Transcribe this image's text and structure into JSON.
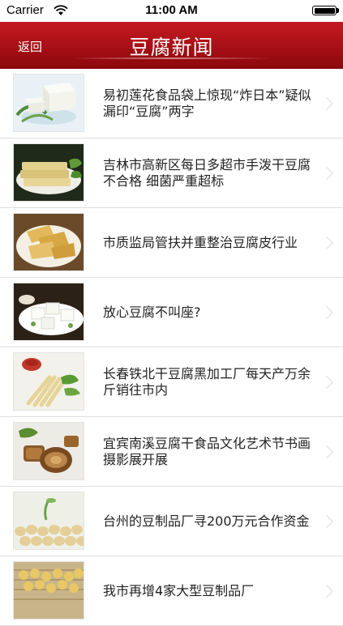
{
  "status_bar": {
    "carrier": "Carrier",
    "time": "11:00 AM"
  },
  "nav": {
    "back_label": "返回",
    "title": "豆腐新闻"
  },
  "news": [
    {
      "title": "易初莲花食品袋上惊现“炸日本”疑似漏印“豆腐”两字",
      "thumb_icon": "tofu-block-photo"
    },
    {
      "title": "吉林市高新区每日多超市手泼干豆腐不合格 细菌严重超标",
      "thumb_icon": "dried-tofu-sheets-photo"
    },
    {
      "title": "市质监局管扶并重整治豆腐皮行业",
      "thumb_icon": "tofu-skin-plate-photo"
    },
    {
      "title": "放心豆腐不叫座?",
      "thumb_icon": "tofu-cubes-photo"
    },
    {
      "title": "长春铁北干豆腐黑加工厂每天产万余斤销往市内",
      "thumb_icon": "tofu-sticks-photo"
    },
    {
      "title": "宜宾南溪豆腐干食品文化艺术节书画摄影展开展",
      "thumb_icon": "braised-tofu-photo"
    },
    {
      "title": "台州的豆制品厂寻200万元合作资金",
      "thumb_icon": "soybeans-photo"
    },
    {
      "title": "我市再增4家大型豆制品厂",
      "thumb_icon": "soybean-basket-photo"
    }
  ]
}
